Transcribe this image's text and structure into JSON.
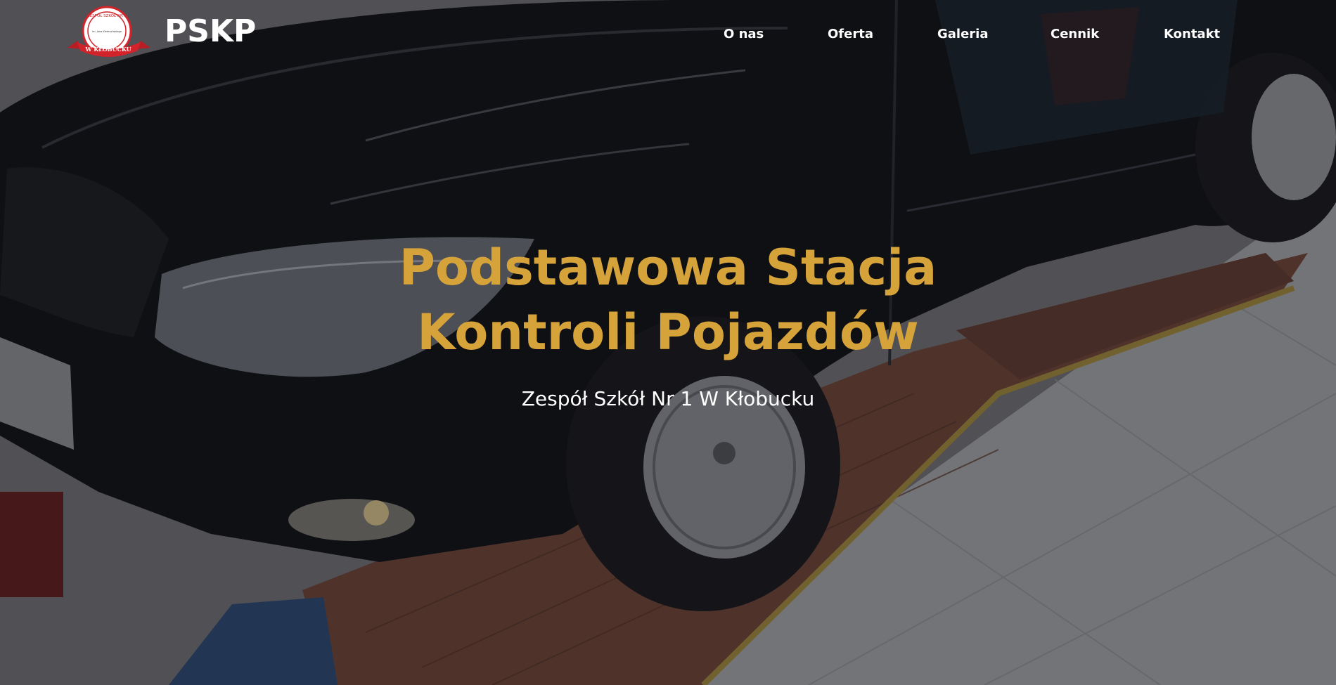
{
  "header": {
    "brand_name": "PSKP",
    "logo": {
      "text_top": "ZESPÓŁ SZKÓŁ NR 1",
      "text_mid": "im. Jana Kiedrzyńskiego",
      "ribbon_text": "W KŁOBUCKU"
    }
  },
  "nav": {
    "items": [
      {
        "label": "O nas"
      },
      {
        "label": "Oferta"
      },
      {
        "label": "Galeria"
      },
      {
        "label": "Cennik"
      },
      {
        "label": "Kontakt"
      }
    ]
  },
  "hero": {
    "title_line1": "Podstawowa Stacja",
    "title_line2": "Kontroli Pojazdów",
    "subtitle": "Zespół Szkół Nr 1 W Kłobucku",
    "background": "car-on-inspection-station-photo"
  },
  "colors": {
    "accent": "#d6a33a",
    "text": "#ffffff",
    "logo_red": "#d2232a"
  }
}
